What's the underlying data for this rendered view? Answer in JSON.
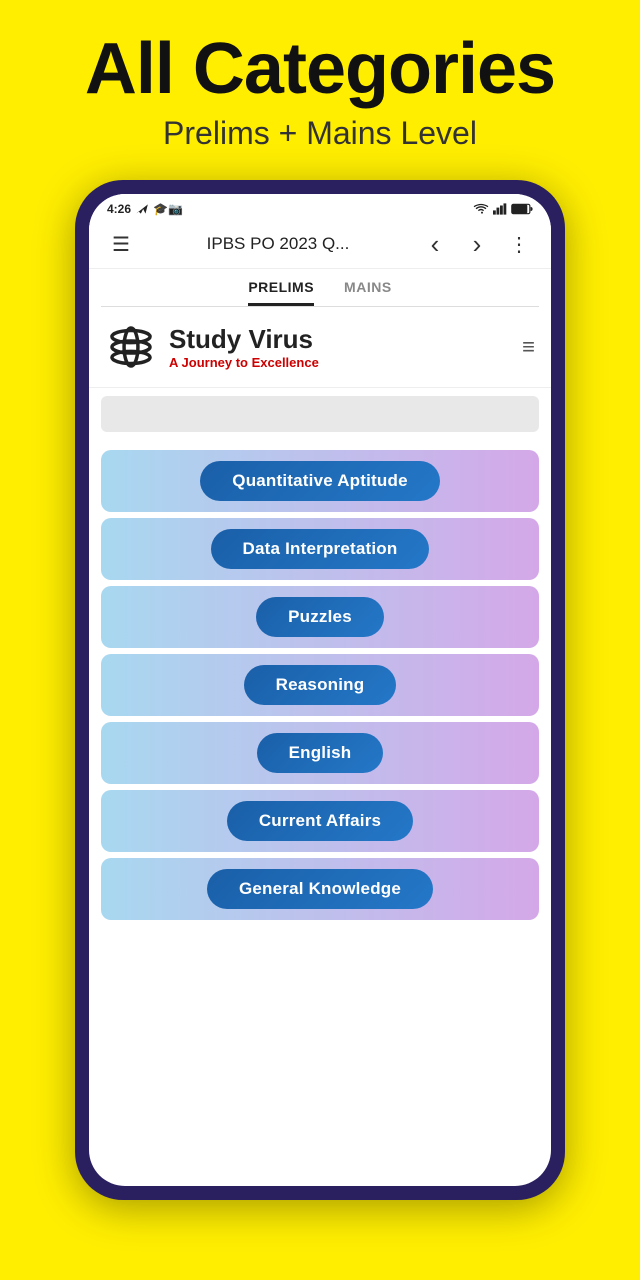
{
  "header": {
    "main_title": "All Categories",
    "subtitle": "Prelims + Mains Level"
  },
  "status_bar": {
    "time": "4:26",
    "wifi": "wifi",
    "signal": "signal",
    "battery": "battery"
  },
  "app_bar": {
    "menu_icon": "☰",
    "title": "IPBS PO 2023 Q...",
    "back_icon": "‹",
    "forward_icon": "›",
    "more_icon": "⋮"
  },
  "tabs": [
    {
      "label": "PRELIMS",
      "active": true
    },
    {
      "label": "MAINS",
      "active": false
    }
  ],
  "logo": {
    "name": "Study Virus",
    "tagline": "A Journey to Excellence",
    "menu_icon": "≡"
  },
  "categories": [
    {
      "label": "Quantitative Aptitude"
    },
    {
      "label": "Data Interpretation"
    },
    {
      "label": "Puzzles"
    },
    {
      "label": "Reasoning"
    },
    {
      "label": "English"
    },
    {
      "label": "Current Affairs"
    },
    {
      "label": "General Knowledge"
    }
  ]
}
